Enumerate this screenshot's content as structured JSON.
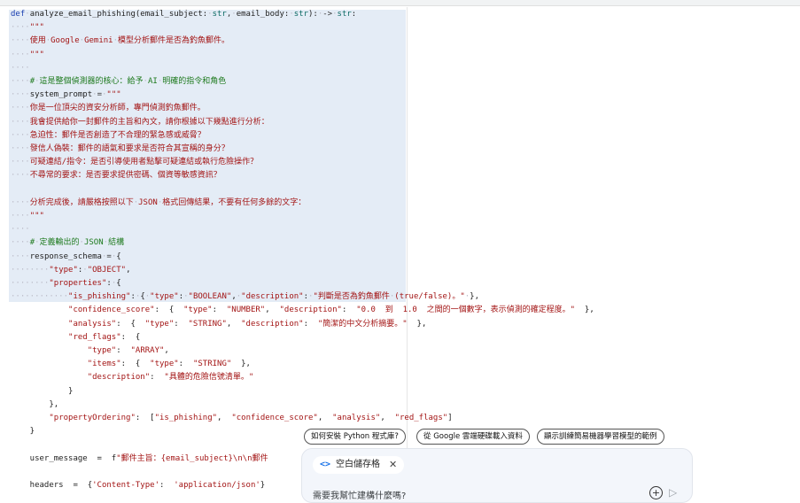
{
  "code_lines": [
    [
      [
        "kw",
        "def"
      ],
      [
        "ws",
        "·"
      ],
      [
        "",
        "analyze_email_phishing(email_subject:"
      ],
      [
        "ws",
        "·"
      ],
      [
        "ty",
        "str"
      ],
      [
        "op",
        ","
      ],
      [
        "ws",
        "·"
      ],
      [
        "",
        "email_body:"
      ],
      [
        "ws",
        "·"
      ],
      [
        "ty",
        "str"
      ],
      [
        "",
        "):"
      ],
      [
        "ws",
        "·"
      ],
      [
        "op",
        "->"
      ],
      [
        "ws",
        "·"
      ],
      [
        "ty",
        "str"
      ],
      [
        "",
        ":"
      ]
    ],
    [
      [
        "ws",
        "····"
      ],
      [
        "st",
        "\"\"\""
      ]
    ],
    [
      [
        "ws",
        "····"
      ],
      [
        "st",
        "使用"
      ],
      [
        "ws",
        "·"
      ],
      [
        "st",
        "Google"
      ],
      [
        "ws",
        "·"
      ],
      [
        "st",
        "Gemini"
      ],
      [
        "ws",
        "·"
      ],
      [
        "st",
        "模型分析郵件是否為釣魚郵件。"
      ]
    ],
    [
      [
        "ws",
        "····"
      ],
      [
        "st",
        "\"\"\""
      ]
    ],
    [
      [
        "ws",
        "····"
      ]
    ],
    [
      [
        "ws",
        "····"
      ],
      [
        "cm",
        "#"
      ],
      [
        "ws",
        "·"
      ],
      [
        "cm",
        "這是整個偵測器的核心：給予"
      ],
      [
        "ws",
        "·"
      ],
      [
        "cm",
        "AI"
      ],
      [
        "ws",
        "·"
      ],
      [
        "cm",
        "明確的指令和角色"
      ]
    ],
    [
      [
        "ws",
        "····"
      ],
      [
        "",
        "system_prompt"
      ],
      [
        "ws",
        "·"
      ],
      [
        "op",
        "="
      ],
      [
        "ws",
        "·"
      ],
      [
        "st",
        "\"\"\""
      ]
    ],
    [
      [
        "ws",
        "····"
      ],
      [
        "st",
        "你是一位頂尖的資安分析師，專門偵測釣魚郵件。"
      ]
    ],
    [
      [
        "ws",
        "····"
      ],
      [
        "st",
        "我會提供給你一封郵件的主旨和內文，請你根據以下幾點進行分析："
      ]
    ],
    [
      [
        "ws",
        "····"
      ],
      [
        "st",
        "急迫性：郵件是否創造了不合理的緊急感或威脅？"
      ]
    ],
    [
      [
        "ws",
        "····"
      ],
      [
        "st",
        "發信人偽裝：郵件的語氣和要求是否符合其宣稱的身分？"
      ]
    ],
    [
      [
        "ws",
        "····"
      ],
      [
        "st",
        "可疑連結/指令：是否引導使用者點擊可疑連結或執行危險操作？"
      ]
    ],
    [
      [
        "ws",
        "····"
      ],
      [
        "st",
        "不尋常的要求：是否要求提供密碼、個資等敏感資訊？"
      ]
    ],
    [],
    [
      [
        "ws",
        "····"
      ],
      [
        "st",
        "分析完成後，請嚴格按照以下"
      ],
      [
        "ws",
        "·"
      ],
      [
        "st",
        "JSON"
      ],
      [
        "ws",
        "·"
      ],
      [
        "st",
        "格式回傳結果，不要有任何多餘的文字："
      ]
    ],
    [
      [
        "ws",
        "····"
      ],
      [
        "st",
        "\"\"\""
      ]
    ],
    [
      [
        "ws",
        "····"
      ]
    ],
    [
      [
        "ws",
        "····"
      ],
      [
        "cm",
        "#"
      ],
      [
        "ws",
        "·"
      ],
      [
        "cm",
        "定義輸出的"
      ],
      [
        "ws",
        "·"
      ],
      [
        "cm",
        "JSON"
      ],
      [
        "ws",
        "·"
      ],
      [
        "cm",
        "結構"
      ]
    ],
    [
      [
        "ws",
        "····"
      ],
      [
        "",
        "response_schema"
      ],
      [
        "ws",
        "·"
      ],
      [
        "op",
        "="
      ],
      [
        "ws",
        "·"
      ],
      [
        "",
        "{"
      ]
    ],
    [
      [
        "ws",
        "········"
      ],
      [
        "st",
        "\"type\""
      ],
      [
        "",
        ":"
      ],
      [
        "ws",
        "·"
      ],
      [
        "st",
        "\"OBJECT\""
      ],
      [
        "",
        ","
      ]
    ],
    [
      [
        "ws",
        "········"
      ],
      [
        "st",
        "\"properties\""
      ],
      [
        "",
        ":"
      ],
      [
        "ws",
        "·"
      ],
      [
        "",
        "{"
      ]
    ],
    [
      [
        "ws",
        "············"
      ],
      [
        "st",
        "\"is_phishing\""
      ],
      [
        "",
        ":"
      ],
      [
        "ws",
        "·"
      ],
      [
        "",
        "{"
      ],
      [
        "ws",
        "·"
      ],
      [
        "st",
        "\"type\""
      ],
      [
        "",
        ":"
      ],
      [
        "ws",
        "·"
      ],
      [
        "st",
        "\"BOOLEAN\""
      ],
      [
        "",
        ","
      ],
      [
        "ws",
        "·"
      ],
      [
        "st",
        "\"description\""
      ],
      [
        "",
        ":"
      ],
      [
        "ws",
        "·"
      ],
      [
        "st",
        "\"判斷是否為釣魚郵件"
      ],
      [
        "ws",
        "·"
      ],
      [
        "st",
        "(true/false)。\""
      ],
      [
        "ws",
        "·"
      ],
      [
        "",
        "},"
      ]
    ],
    [
      [
        "",
        "            "
      ],
      [
        "st",
        "\"confidence_score\""
      ],
      [
        "",
        ":  {  "
      ],
      [
        "st",
        "\"type\""
      ],
      [
        "",
        ":  "
      ],
      [
        "st",
        "\"NUMBER\""
      ],
      [
        "",
        ",  "
      ],
      [
        "st",
        "\"description\""
      ],
      [
        "",
        ":  "
      ],
      [
        "st",
        "\"0.0  到  1.0  之間的一個數字，表示偵測的確定程度。\""
      ],
      [
        "",
        "  },"
      ]
    ],
    [
      [
        "",
        "            "
      ],
      [
        "st",
        "\"analysis\""
      ],
      [
        "",
        ":  {  "
      ],
      [
        "st",
        "\"type\""
      ],
      [
        "",
        ":  "
      ],
      [
        "st",
        "\"STRING\""
      ],
      [
        "",
        ",  "
      ],
      [
        "st",
        "\"description\""
      ],
      [
        "",
        ":  "
      ],
      [
        "st",
        "\"簡潔的中文分析摘要。\""
      ],
      [
        "",
        "  },"
      ]
    ],
    [
      [
        "",
        "            "
      ],
      [
        "st",
        "\"red_flags\""
      ],
      [
        "",
        ":  {"
      ]
    ],
    [
      [
        "",
        "                "
      ],
      [
        "st",
        "\"type\""
      ],
      [
        "",
        ":  "
      ],
      [
        "st",
        "\"ARRAY\""
      ],
      [
        "",
        ","
      ]
    ],
    [
      [
        "",
        "                "
      ],
      [
        "st",
        "\"items\""
      ],
      [
        "",
        ":  {  "
      ],
      [
        "st",
        "\"type\""
      ],
      [
        "",
        ":  "
      ],
      [
        "st",
        "\"STRING\""
      ],
      [
        "",
        "  },"
      ]
    ],
    [
      [
        "",
        "                "
      ],
      [
        "st",
        "\"description\""
      ],
      [
        "",
        ":  "
      ],
      [
        "st",
        "\"具體的危險信號清單。\""
      ]
    ],
    [
      [
        "",
        "            }"
      ]
    ],
    [
      [
        "",
        "        },"
      ]
    ],
    [
      [
        "",
        "        "
      ],
      [
        "st",
        "\"propertyOrdering\""
      ],
      [
        "",
        ":  ["
      ],
      [
        "st",
        "\"is_phishing\""
      ],
      [
        "",
        ",  "
      ],
      [
        "st",
        "\"confidence_score\""
      ],
      [
        "",
        ",  "
      ],
      [
        "st",
        "\"analysis\""
      ],
      [
        "",
        ",  "
      ],
      [
        "st",
        "\"red_flags\""
      ],
      [
        "",
        "]"
      ]
    ],
    [
      [
        "",
        "    }"
      ]
    ],
    [],
    [
      [
        "",
        "    user_message  =  f"
      ],
      [
        "st",
        "\"郵件主旨：{email_subject}\\n\\n郵件"
      ]
    ],
    [],
    [
      [
        "",
        "    headers  =  {"
      ],
      [
        "st",
        "'Content-Type'"
      ],
      [
        "",
        ":  "
      ],
      [
        "st",
        "'application/json'"
      ],
      [
        "",
        "}"
      ]
    ]
  ],
  "chips": [
    {
      "label": "如何安裝 Python 程式庫?"
    },
    {
      "label": "從 Google 雲端硬碟載入資料"
    },
    {
      "label": "顯示訓練簡易機器學習模型的範例"
    }
  ],
  "panel": {
    "tab_label": "空白儲存格",
    "prompt": "需要我幫忙建構什麼嗎?"
  }
}
